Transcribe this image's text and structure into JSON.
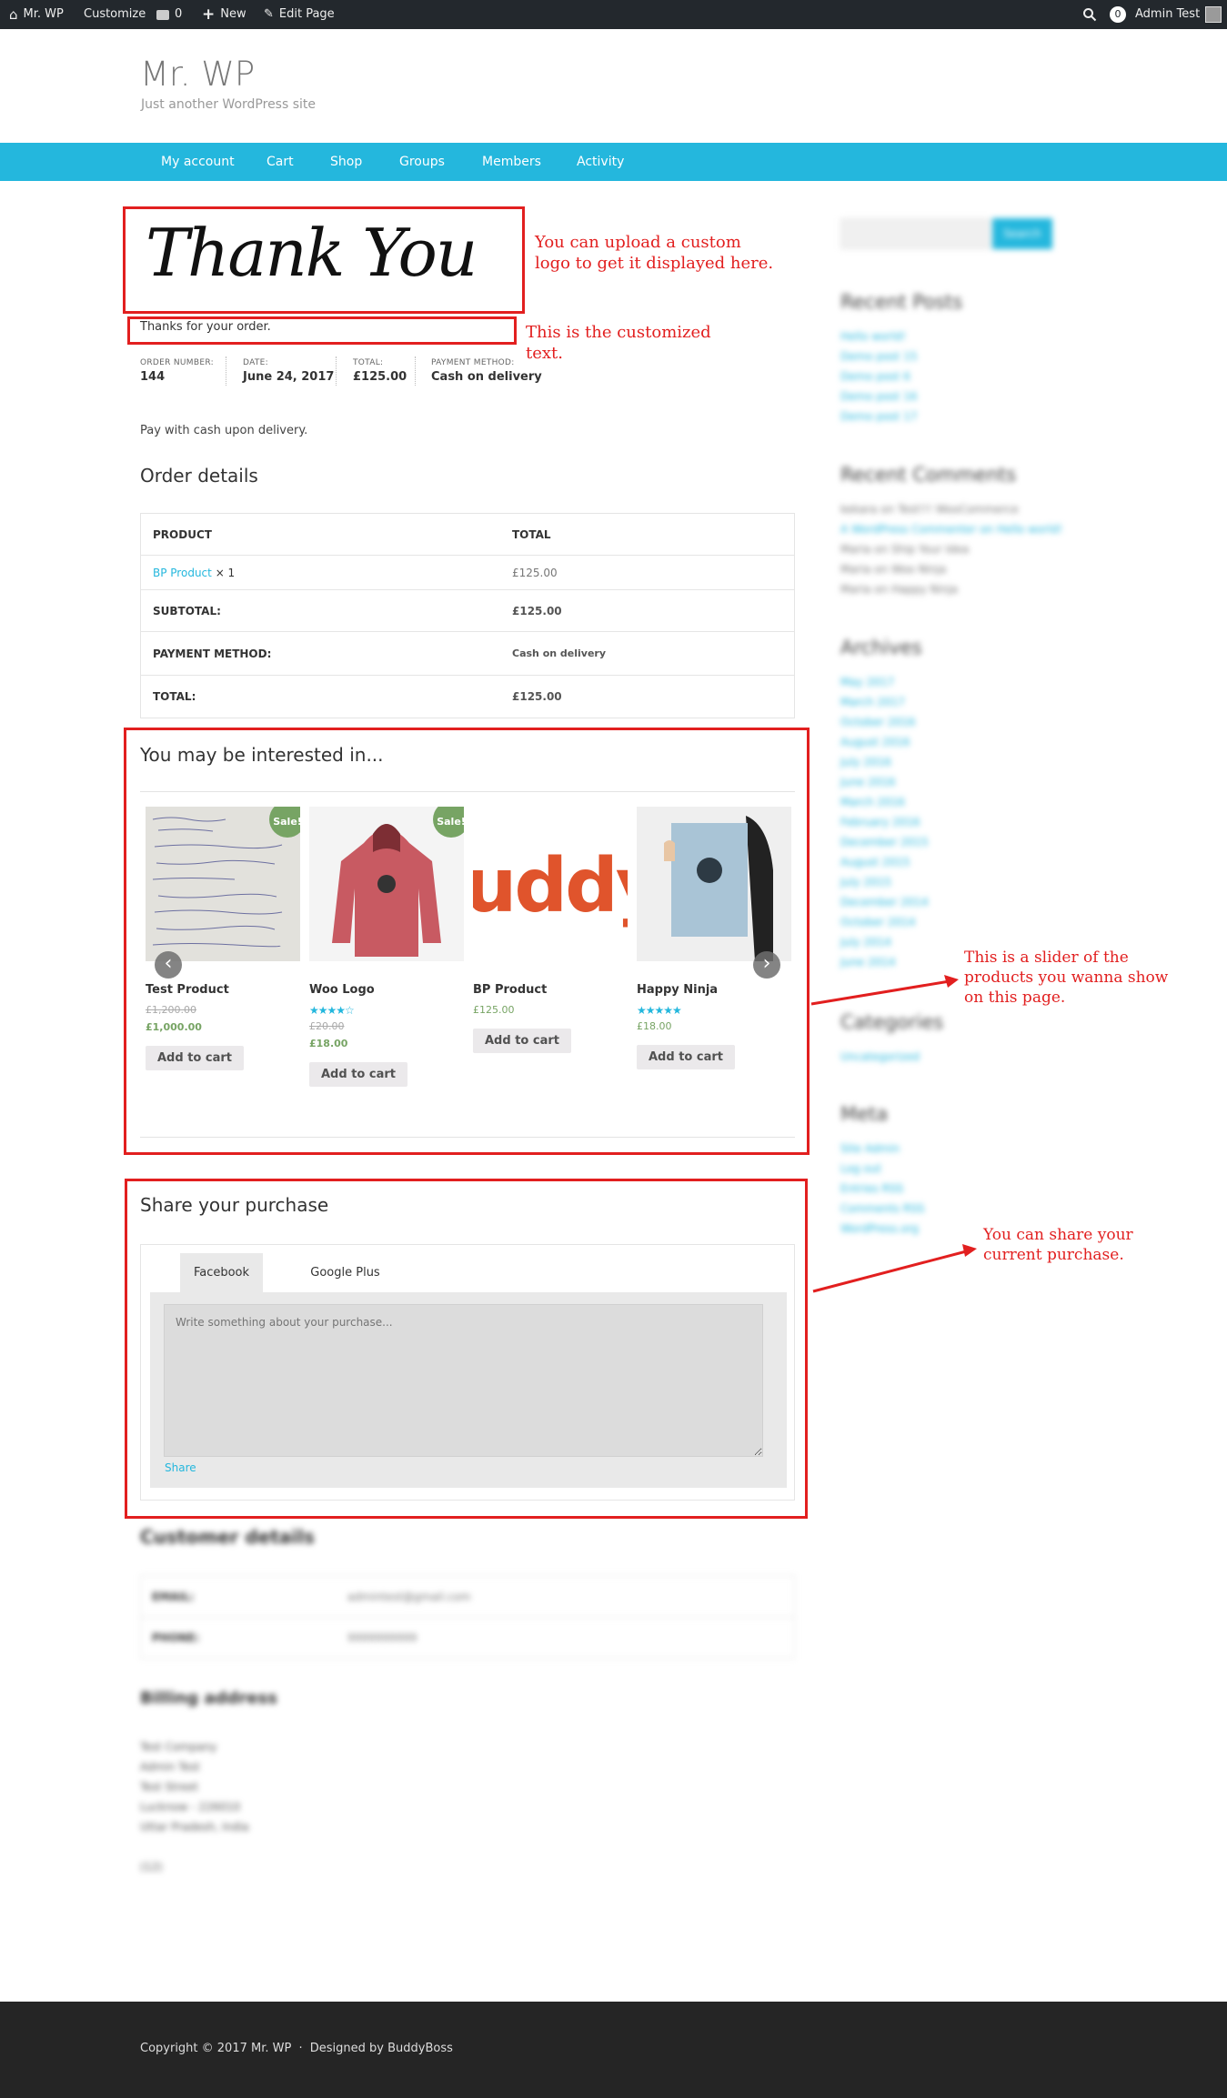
{
  "admin_bar": {
    "site": "Mr. WP",
    "customize": "Customize",
    "comments": "0",
    "new": "New",
    "edit": "Edit Page",
    "cart_count": "0",
    "user": "Admin Test"
  },
  "site": {
    "title": "Mr. WP",
    "tagline": "Just another WordPress site"
  },
  "nav": [
    "My account",
    "Cart",
    "Shop",
    "Groups",
    "Members",
    "Activity"
  ],
  "logo_text": "Thank You",
  "thanks_text": "Thanks for your order.",
  "annotations": {
    "logo": "You can upload a custom logo to get it displayed here.",
    "text": "This is the customized text.",
    "slider": "This is a slider of the products you wanna show on this page.",
    "share": "You can share your current purchase."
  },
  "order_meta": [
    {
      "label": "ORDER NUMBER:",
      "value": "144"
    },
    {
      "label": "DATE:",
      "value": "June 24, 2017"
    },
    {
      "label": "TOTAL:",
      "value": "£125.00"
    },
    {
      "label": "PAYMENT METHOD:",
      "value": "Cash on delivery"
    }
  ],
  "payment_note": "Pay with cash upon delivery.",
  "order_details": {
    "heading": "Order details",
    "head": {
      "product": "PRODUCT",
      "total": "TOTAL"
    },
    "item": {
      "name": "BP Product",
      "qty": "× 1",
      "total": "£125.00"
    },
    "subtotal": {
      "label": "SUBTOTAL:",
      "value": "£125.00"
    },
    "payment": {
      "label": "PAYMENT METHOD:",
      "value": "Cash on delivery"
    },
    "total": {
      "label": "TOTAL:",
      "value": "£125.00"
    }
  },
  "related": {
    "heading": "You may be interested in...",
    "products": [
      {
        "name": "Test Product",
        "old": "£1,200.00",
        "price": "£1,000.00",
        "badge": "Sale!",
        "button": "Add to cart"
      },
      {
        "name": "Woo Logo",
        "stars": "★★★★☆",
        "old": "£20.00",
        "price": "£18.00",
        "badge": "Sale!",
        "button": "Add to cart"
      },
      {
        "name": "BP Product",
        "price": "£125.00",
        "button": "Add to cart",
        "image_text": "uddy"
      },
      {
        "name": "Happy Ninja",
        "stars": "★★★★★",
        "price": "£18.00",
        "button": "Add to cart"
      }
    ]
  },
  "share": {
    "heading": "Share your purchase",
    "tabs": [
      "Facebook",
      "Google Plus"
    ],
    "placeholder": "Write something about your purchase...",
    "button": "Share"
  },
  "customer": {
    "heading": "Customer details",
    "rows": [
      {
        "label": "EMAIL:",
        "value": "admintest@gmail.com"
      },
      {
        "label": "PHONE:",
        "value": "9999999999"
      }
    ]
  },
  "billing": {
    "heading": "Billing address",
    "lines": [
      "Test Company",
      "Admin Test",
      "Test Street",
      "Lucknow - 226010",
      "Uttar Pradesh, India",
      "",
      "(12)"
    ]
  },
  "sidebar": {
    "search_button": "Search",
    "recent_posts": {
      "title": "Recent Posts",
      "items": [
        "Hello world!",
        "Demo post 15",
        "Demo post 6",
        "Demo post 16",
        "Demo post 17"
      ]
    },
    "recent_comments": {
      "title": "Recent Comments",
      "items": [
        "kekara on Test!!! WooCommerce",
        "A WordPress Commenter on Hello world!",
        "Maria on Ship Your Idea",
        "Maria on Woo Ninja",
        "Maria on Happy Ninja"
      ]
    },
    "archives": {
      "title": "Archives",
      "items": [
        "May 2017",
        "March 2017",
        "October 2016",
        "August 2016",
        "July 2016",
        "June 2016",
        "March 2016",
        "February 2016",
        "December 2015",
        "August 2015",
        "July 2015",
        "December 2014",
        "October 2014",
        "July 2014",
        "June 2014"
      ]
    },
    "categories": {
      "title": "Categories",
      "items": [
        "Uncategorized"
      ]
    },
    "meta": {
      "title": "Meta",
      "items": [
        "Site Admin",
        "Log out",
        "Entries RSS",
        "Comments RSS",
        "WordPress.org"
      ]
    }
  },
  "footer": {
    "copyright": "Copyright © 2017 Mr. WP",
    "sep": "·",
    "designed": "Designed by BuddyBoss"
  },
  "colors": {
    "accent": "#24b7dd",
    "annotation": "#e21f1f",
    "sale": "#77a464",
    "adminbar": "#23282d",
    "footer": "#252525"
  }
}
